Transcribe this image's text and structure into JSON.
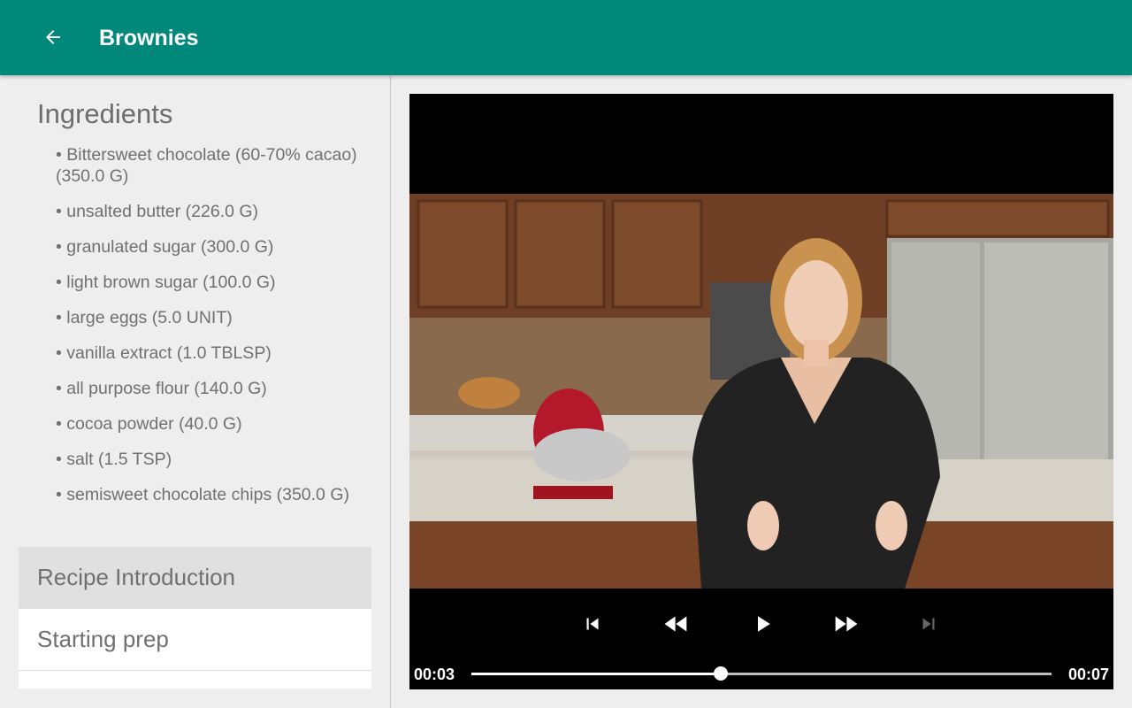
{
  "app_bar": {
    "title": "Brownies",
    "back_icon": "arrow-back-icon",
    "color": "#00897b"
  },
  "ingredients": {
    "heading": "Ingredients",
    "items": [
      "• Bittersweet chocolate (60-70% cacao) (350.0 G)",
      "• unsalted butter (226.0 G)",
      "• granulated sugar (300.0 G)",
      "• light brown sugar (100.0 G)",
      "• large eggs (5.0 UNIT)",
      "• vanilla extract (1.0 TBLSP)",
      "• all purpose flour (140.0 G)",
      "• cocoa powder (40.0 G)",
      "• salt (1.5 TSP)",
      "• semisweet chocolate chips (350.0 G)"
    ]
  },
  "steps": [
    {
      "label": "Recipe Introduction",
      "selected": true
    },
    {
      "label": "Starting prep",
      "selected": false
    }
  ],
  "player": {
    "controls": [
      "skip-previous-icon",
      "rewind-icon",
      "play-icon",
      "fast-forward-icon",
      "skip-next-icon"
    ],
    "skip_next_enabled": false,
    "position": "00:03",
    "duration": "00:07",
    "progress": 0.43
  }
}
